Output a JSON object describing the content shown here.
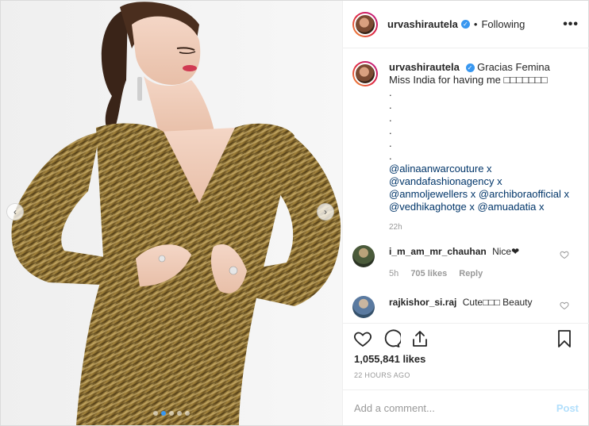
{
  "header": {
    "username": "urvashirautela",
    "separator": "•",
    "follow_status": "Following",
    "more_label": "•••",
    "verified_mark": "✓"
  },
  "caption": {
    "username": "urvashirautela",
    "text": "Gracias Femina Miss India for having me □□□□□□□",
    "dots": [
      ".",
      ".",
      ".",
      ".",
      ".",
      "."
    ],
    "mentions": "@alinaanwarcouture x @vandafashionagency x @anmoljewellers x @archiboraofficial x @vedhikaghotge x @amuadatia x",
    "time": "22h"
  },
  "comments": [
    {
      "username": "i_m_am_mr_chauhan",
      "text": "Nice❤",
      "time": "5h",
      "likes": "705 likes",
      "reply": "Reply"
    },
    {
      "username": "rajkishor_si.raj",
      "text": "Cute□□□ Beauty"
    }
  ],
  "actions": {
    "likes": "1,055,841 likes",
    "timestamp": "22 HOURS AGO",
    "comment_placeholder": "Add a comment...",
    "post_label": "Post"
  },
  "media": {
    "carousel_count": 5,
    "carousel_active": 1,
    "prev_glyph": "‹",
    "next_glyph": "›"
  },
  "colors": {
    "accent": "#3897f0",
    "mention": "#003569",
    "muted": "#999999",
    "border": "#efefef",
    "post_disabled": "#b2dffc",
    "dress_gold": "#8a6a2a"
  },
  "icons": [
    "heart-icon",
    "comment-icon",
    "share-icon",
    "bookmark-icon",
    "more-icon",
    "verified-icon",
    "chevron-left-icon",
    "chevron-right-icon"
  ]
}
